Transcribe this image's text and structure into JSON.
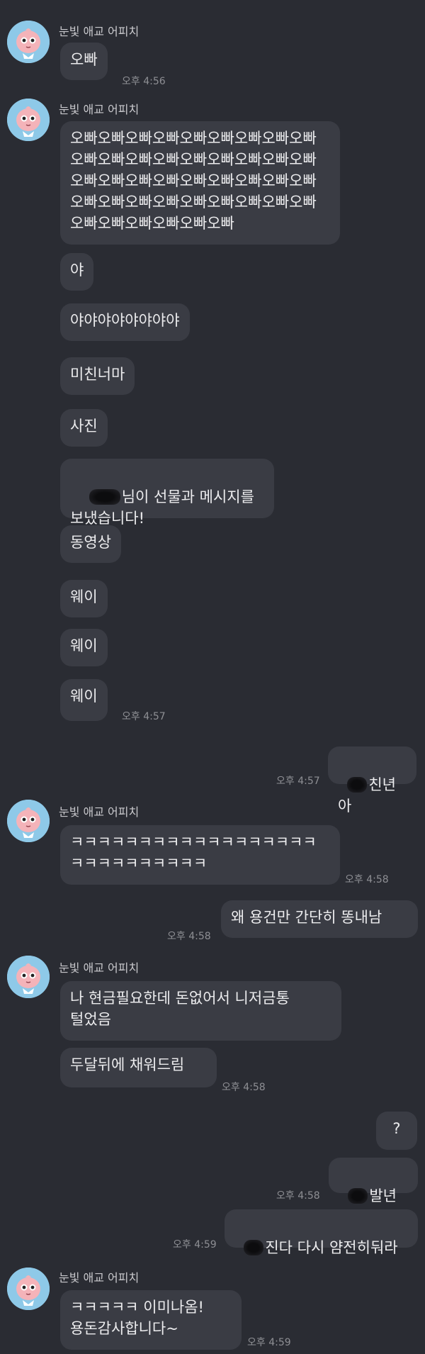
{
  "sender_name": "눈빛 애교 어피치",
  "messages": {
    "m1": "오빠",
    "m2": "오빠오빠오빠오빠오빠오빠오빠오빠오빠오빠오빠오빠오빠오빠오빠오빠오빠오빠오빠오빠오빠오빠오빠오빠오빠오빠오빠오빠오빠오빠오빠오빠오빠오빠오빠오빠오빠오빠오빠오빠오빠오빠",
    "m3": "야",
    "m4": "야야야야야야야야",
    "m5": "미친너마",
    "m6": "사진",
    "m7_suffix": "님이 선물과 메시지를\n보냈습니다!",
    "m8": "동영상",
    "m9": "웨이",
    "m10": "웨이",
    "m11": "웨이",
    "out1_suffix": "친년아",
    "m12": "ㅋㅋㅋㅋㅋㅋㅋㅋㅋㅋㅋㅋㅋㅋㅋㅋㅋㅋㅋㅋㅋㅋㅋㅋㅋㅋㅋㅋ",
    "out2": "왜 용건만 간단히 똥내남",
    "m13": "나 현금필요한데 돈없어서 니저금통\n털었음",
    "m14": "두달뒤에 채워드림",
    "out3": "?",
    "out4_suffix": "발년이",
    "out5_suffix": "진다 다시 얌전히둬라",
    "m15": "ㅋㅋㅋㅋㅋ 이미나옴!\n용돈감사합니다~"
  },
  "times": {
    "t456": "오후 4:56",
    "t457a": "오후 4:57",
    "t457b": "오후 4:57",
    "t458a": "오후 4:58",
    "t458b": "오후 4:58",
    "t458c": "오후 4:58",
    "t458d": "오후 4:58",
    "t459a": "오후 4:59",
    "t459b": "오후 4:59"
  },
  "colors": {
    "background": "#2a2c33",
    "bubble": "#3a3c44",
    "avatar_bg": "#8ec9e8",
    "avatar_face": "#f4b3b9"
  },
  "icons": {
    "avatar": "peach-character-avatar",
    "redaction": "blur-redaction"
  }
}
